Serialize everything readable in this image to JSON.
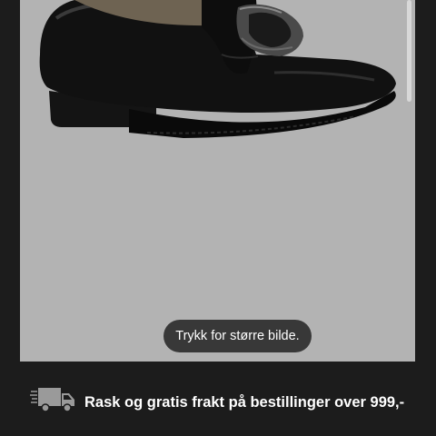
{
  "product_image": {
    "zoom_hint": "Trykk for større bilde.",
    "background_color": "#b3b3b3",
    "subject_icon": "black-leather-buckle-loafer"
  },
  "shipping": {
    "icon": "delivery-truck-icon",
    "text": "Rask og gratis frakt på bestillinger over 999,-"
  },
  "colors": {
    "page_background": "#1c1c1c",
    "pill_background": "#383838",
    "text": "#ffffff"
  }
}
